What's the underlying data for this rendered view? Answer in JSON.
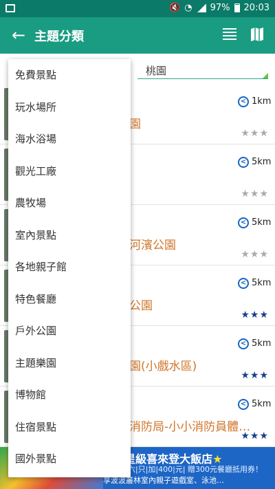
{
  "status_bar": {
    "battery": "97%",
    "time": "20:03"
  },
  "app_bar": {
    "title": "主題分類",
    "back_icon": "arrow-back-icon",
    "list_icon": "list-view-icon",
    "map_icon": "map-icon"
  },
  "filter": {
    "city": "桃園"
  },
  "items": [
    {
      "distance": "1km",
      "name": "園",
      "rating": 0
    },
    {
      "distance": "5km",
      "name": "",
      "rating": 0
    },
    {
      "distance": "5km",
      "name": "河濱公園",
      "rating": 0
    },
    {
      "distance": "5km",
      "name": "公園",
      "rating": 3
    },
    {
      "distance": "5km",
      "name": "園(小戲水區)",
      "rating": 3
    },
    {
      "distance": "5km",
      "name": "消防局-小小消防員體…",
      "rating": 3
    }
  ],
  "dropdown": {
    "options": [
      "免費景點",
      "玩水場所",
      "海水浴場",
      "觀光工廠",
      "農牧場",
      "室內景點",
      "各地親子館",
      "特色餐廳",
      "戶外公園",
      "主題樂園",
      "博物館",
      "住宿景點",
      "國外景點"
    ]
  },
  "banner": {
    "line1": "5星級喜來登大飯店",
    "line2": "六|只|加|400|元|",
    "line3": "享波波叢林室內親子遊戲室、泳池…",
    "line2b": "贈300元餐廳抵用券！"
  },
  "colors": {
    "primary": "#1a9c82",
    "status": "#0c7a68",
    "accent": "#d0752a",
    "star_filled": "#1a3f8a",
    "star_empty": "#aaaaaa"
  }
}
